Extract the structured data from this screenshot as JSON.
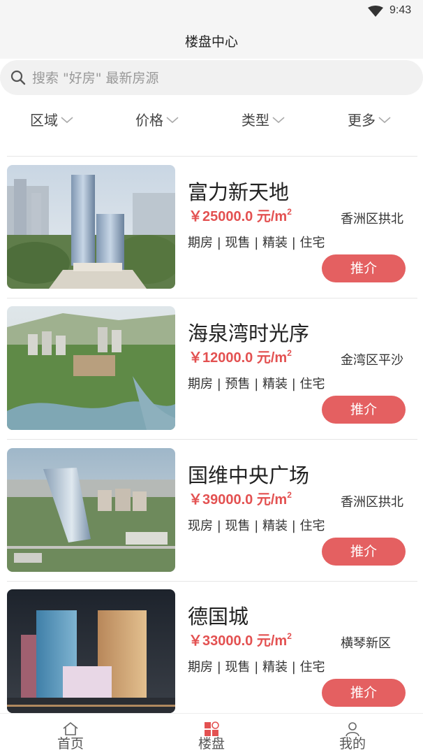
{
  "status_bar": {
    "time": "9:43",
    "icon": "wifi-icon"
  },
  "header": {
    "title": "楼盘中心"
  },
  "search": {
    "placeholder": "搜索 \"好房\" 最新房源",
    "icon": "search-icon"
  },
  "filters": [
    {
      "label": "区域"
    },
    {
      "label": "价格"
    },
    {
      "label": "类型"
    },
    {
      "label": "更多"
    }
  ],
  "listings": [
    {
      "name": "富力新天地",
      "price": "￥25000.0 元/m",
      "price_unit_sup": "2",
      "district": "香洲区拱北",
      "tags": "期房 | 现售 | 精装 | 住宅",
      "button": "推介"
    },
    {
      "name": "海泉湾时光序",
      "price": "￥12000.0 元/m",
      "price_unit_sup": "2",
      "district": "金湾区平沙",
      "tags": "期房 | 预售 | 精装 | 住宅",
      "button": "推介"
    },
    {
      "name": "国维中央广场",
      "price": "￥39000.0 元/m",
      "price_unit_sup": "2",
      "district": "香洲区拱北",
      "tags": "现房 | 现售 | 精装 | 住宅",
      "button": "推介"
    },
    {
      "name": "德国城",
      "price": "￥33000.0 元/m",
      "price_unit_sup": "2",
      "district": "横琴新区",
      "tags": "期房 | 现售 | 精装 | 住宅",
      "button": "推介"
    }
  ],
  "bottom_nav": [
    {
      "label": "首页",
      "icon": "home-icon",
      "active": false
    },
    {
      "label": "楼盘",
      "icon": "buildings-icon",
      "active": true
    },
    {
      "label": "我的",
      "icon": "profile-icon",
      "active": false
    }
  ],
  "colors": {
    "accent": "#e46061",
    "price": "#e35151",
    "background": "#f5f5f5"
  }
}
